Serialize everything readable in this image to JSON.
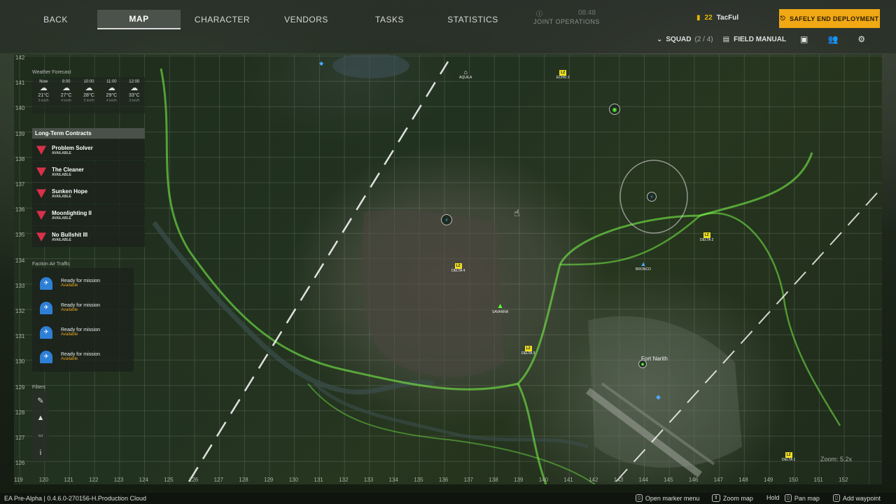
{
  "nav": {
    "tabs": [
      {
        "label": "BACK"
      },
      {
        "label": "MAP"
      },
      {
        "label": "CHARACTER"
      },
      {
        "label": "VENDORS"
      },
      {
        "label": "TASKS"
      },
      {
        "label": "STATISTICS"
      },
      {
        "label": "JOINT OPERATIONS"
      }
    ],
    "joint_ops_time": "08:48",
    "player_level": "22",
    "player_name": "TacFul",
    "end_button": "SAFELY END DEPLOYMENT",
    "squad_label": "SQUAD",
    "squad_count": "(2 / 4)",
    "field_manual": "FIELD MANUAL"
  },
  "map": {
    "y_labels": [
      "142",
      "141",
      "140",
      "139",
      "138",
      "137",
      "136",
      "135",
      "134",
      "133",
      "132",
      "131",
      "130",
      "129",
      "128",
      "127",
      "126"
    ],
    "x_labels": [
      "119",
      "120",
      "121",
      "122",
      "123",
      "124",
      "125",
      "126",
      "127",
      "128",
      "129",
      "130",
      "131",
      "132",
      "133",
      "134",
      "135",
      "136",
      "137",
      "138",
      "139",
      "140",
      "141",
      "142",
      "143",
      "144",
      "145",
      "146",
      "147",
      "148",
      "149",
      "150",
      "151",
      "152"
    ],
    "zoom": "Zoom: 5.2x",
    "poi": [
      {
        "label": "AQUILA"
      },
      {
        "label": "ECHO 2"
      },
      {
        "label": "DELTA 4"
      },
      {
        "label": "SAVANNA"
      },
      {
        "label": "DELTA 3"
      },
      {
        "label": "DELTA 2"
      },
      {
        "label": "BRONCO"
      },
      {
        "label": "Fort Narith"
      },
      {
        "label": "DELTA 1"
      }
    ],
    "lz_tag": "LZ"
  },
  "weather": {
    "title": "Weather Forecast",
    "items": [
      {
        "time": "Now",
        "temp": "21°C",
        "sub": "5 km/h"
      },
      {
        "time": "9:00",
        "temp": "27°C",
        "sub": "4 km/h"
      },
      {
        "time": "10:00",
        "temp": "28°C",
        "sub": "5 km/h"
      },
      {
        "time": "11:00",
        "temp": "29°C",
        "sub": "4 km/h"
      },
      {
        "time": "12:00",
        "temp": "33°C",
        "sub": "3 km/h"
      }
    ]
  },
  "contracts": {
    "title": "Long-Term Contracts",
    "items": [
      {
        "name": "Problem Solver",
        "status": "AVAILABLE"
      },
      {
        "name": "The Cleaner",
        "status": "AVAILABLE"
      },
      {
        "name": "Sunken Hope",
        "status": "AVAILABLE"
      },
      {
        "name": "Moonlighting II",
        "status": "AVAILABLE"
      },
      {
        "name": "No Bullshit III",
        "status": "AVAILABLE"
      }
    ]
  },
  "air_traffic": {
    "title": "Faction Air Traffic",
    "items": [
      {
        "line1": "Ready for mission",
        "line2": "Available"
      },
      {
        "line1": "Ready for mission",
        "line2": "Available"
      },
      {
        "line1": "Ready for mission",
        "line2": "Available"
      },
      {
        "line1": "Ready for mission",
        "line2": "Available"
      }
    ]
  },
  "filters": {
    "title": "Filters"
  },
  "bottom": {
    "build": "EA Pre-Alpha | 0.4.6.0-270156-H.Production Cloud",
    "hints": [
      {
        "label": "Open marker menu"
      },
      {
        "label": "Zoom map"
      },
      {
        "label": "Hold"
      },
      {
        "label": "Pan map"
      },
      {
        "label": "Add waypoint"
      }
    ]
  },
  "colors": {
    "accent": "#f0a814",
    "contract": "#d8304a",
    "air": "#2e7fd6",
    "route": "#7dff4a",
    "lz": "#f0e020"
  }
}
